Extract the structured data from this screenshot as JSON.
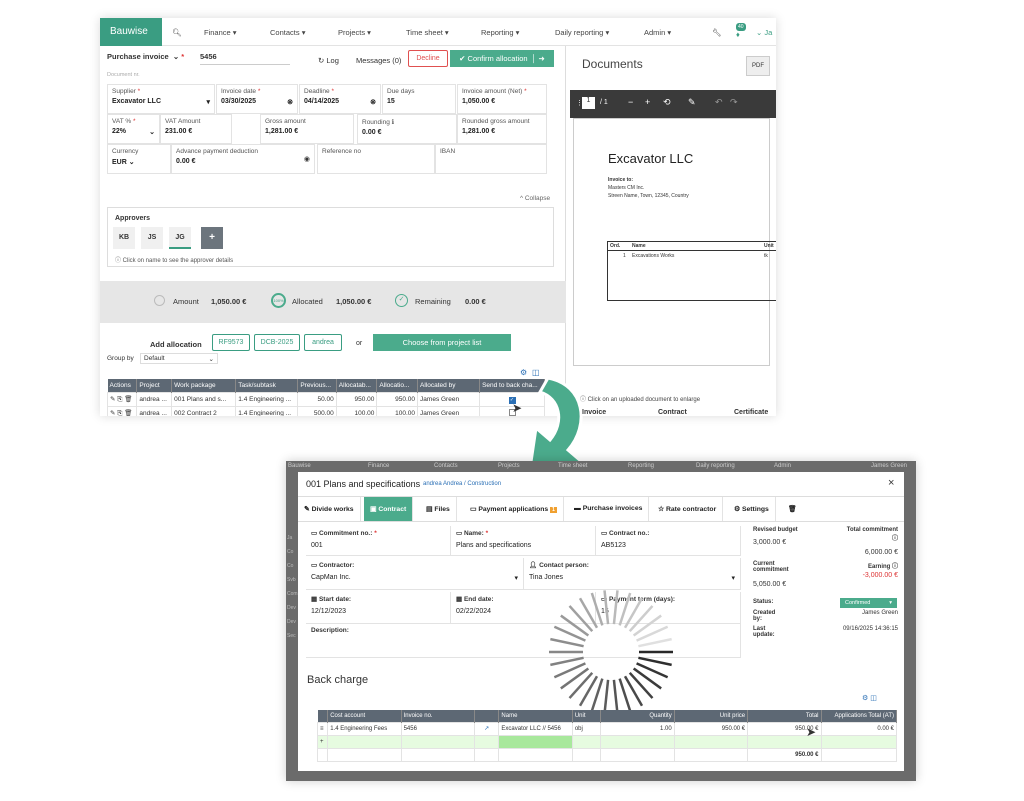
{
  "top": {
    "brand": "Bauwise",
    "menu": [
      "Finance",
      "Contacts",
      "Projects",
      "Time sheet",
      "Reporting",
      "Daily reporting",
      "Admin"
    ],
    "notif_count": "40",
    "user_initials": "Ja",
    "doc_type": "Purchase invoice",
    "doc_number": "5456",
    "log": "Log",
    "messages": "Messages (0)",
    "decline": "Decline",
    "confirm": "Confirm allocation",
    "document_nr": "Document nr.",
    "fields": {
      "supplier_l": "Supplier",
      "supplier_v": "Excavator LLC",
      "invdate_l": "Invoice date",
      "invdate_v": "03/30/2025",
      "deadline_l": "Deadline",
      "deadline_v": "04/14/2025",
      "duedays_l": "Due days",
      "duedays_v": "15",
      "invamount_l": "Invoice amount (Net)",
      "invamount_v": "1,050.00 €",
      "vat_l": "VAT %",
      "vat_v": "22%",
      "vatamount_l": "VAT Amount",
      "vatamount_v": "231.00 €",
      "gross_l": "Gross amount",
      "gross_v": "1,281.00 €",
      "rounding_l": "Rounding",
      "rounding_v": "0.00 €",
      "rgross_l": "Rounded gross amount",
      "rgross_v": "1,281.00 €",
      "currency_l": "Currency",
      "currency_v": "EUR",
      "advance_l": "Advance payment deduction",
      "advance_v": "0.00 €",
      "ref_l": "Reference no",
      "iban_l": "IBAN"
    },
    "collapse": "Collapse",
    "approvers_title": "Approvers",
    "approvers": [
      "KB",
      "JS",
      "JG"
    ],
    "approver_add": "+",
    "approver_hint": "Click on name to see the approver details",
    "summary": {
      "amount_l": "Amount",
      "amount_v": "1,050.00 €",
      "alloc_l": "Allocated",
      "alloc_v": "1,050.00 €",
      "remain_l": "Remaining",
      "remain_v": "0.00 €",
      "alloc_pct": "100%"
    },
    "add_allocation": "Add allocation",
    "alloc_tags": [
      "RF9573",
      "DCB-2025",
      "andrea"
    ],
    "or": "or",
    "choose": "Choose from project list",
    "groupby_l": "Group by",
    "groupby_v": "Default",
    "table_headers": [
      "Actions",
      "Project",
      "Work package",
      "Task/subtask",
      "Previous...",
      "Allocatab...",
      "Allocatio...",
      "Allocated by",
      "Send to back cha..."
    ],
    "rows": [
      [
        "andrea ...",
        "001 Plans and s...",
        "1.4 Engineering ...",
        "50.00",
        "950.00",
        "950.00",
        "James Green"
      ],
      [
        "andrea ...",
        "002 Contract 2",
        "1.4 Engineering ...",
        "500.00",
        "100.00",
        "100.00",
        "James Green"
      ]
    ]
  },
  "docs": {
    "title": "Documents",
    "pdf": "PDF",
    "page": "1",
    "pages": "/ 1",
    "company": "Excavator LLC",
    "invoice_to": "Invoice to:",
    "addr1": "Masters CM Inc.",
    "addr2": "Streen Name, Town, 12345, Country",
    "th": [
      "Ord.",
      "Name",
      "Unit"
    ],
    "row": [
      "1",
      "Excavations Works",
      "tk"
    ],
    "hint": "Click on an uploaded document to enlarge",
    "cols": [
      "Invoice",
      "Contract",
      "Certificate"
    ]
  },
  "bottom": {
    "bg_menu": [
      "Bauwise",
      "Finance",
      "Contacts",
      "Projects",
      "Time sheet",
      "Reporting",
      "Daily reporting",
      "Admin",
      "James Green"
    ],
    "title": "001 Plans and specifications",
    "crumb": "andrea Andrea / Construction",
    "close": "×",
    "tabs": [
      "Divide works",
      "Contract",
      "Files",
      "Payment applications",
      "Purchase invoices",
      "Rate contractor",
      "Settings"
    ],
    "pay_badge": "1",
    "commit_no_l": "Commitment no.:",
    "commit_no_v": "001",
    "name_l": "Name:",
    "name_v": "Plans and specifications",
    "contract_no_l": "Contract no.:",
    "contract_no_v": "AB5123",
    "contractor_l": "Contractor:",
    "contractor_v": "CapMan Inc.",
    "contact_l": "Contact person:",
    "contact_v": "Tina Jones",
    "start_l": "Start date:",
    "start_v": "12/12/2023",
    "end_l": "End date:",
    "end_v": "02/22/2024",
    "payterm_l": "Payment term (days):",
    "payterm_v": "15",
    "desc_l": "Description:",
    "revised_l": "Revised budget",
    "revised_v": "3,000.00 €",
    "total_l": "Total commitment",
    "total_v": "6,000.00 €",
    "current_l": "Current commitment",
    "current_v": "5,050.00 €",
    "earning_l": "Earning",
    "earning_v": "-3,000.00 €",
    "status_l": "Status:",
    "status_v": "Confirmed",
    "created_l": "Created by:",
    "created_v": "James Green",
    "update_l": "Last update:",
    "update_v": "09/16/2025 14:36:15",
    "back_charge": "Back charge",
    "bt_headers": [
      "Cost account",
      "Invoice no.",
      "",
      "Name",
      "Unit",
      "Quantity",
      "Unit price",
      "Total",
      "Applications Total (AT)"
    ],
    "bt_row": [
      "1.4 Engineering Fees",
      "5456",
      "",
      "Excavator LLC // 5456",
      "obj",
      "1.00",
      "950.00 €",
      "950.00 €",
      "0.00 €"
    ],
    "bt_total": "950.00 €",
    "bg_left": [
      "Ja",
      "Co",
      "Co",
      "Svb",
      "Com",
      "Dev",
      "Dev",
      "Sec"
    ]
  },
  "colors": {
    "accent": "#3a9d82",
    "header": "#5d6874",
    "negative": "#d33"
  }
}
